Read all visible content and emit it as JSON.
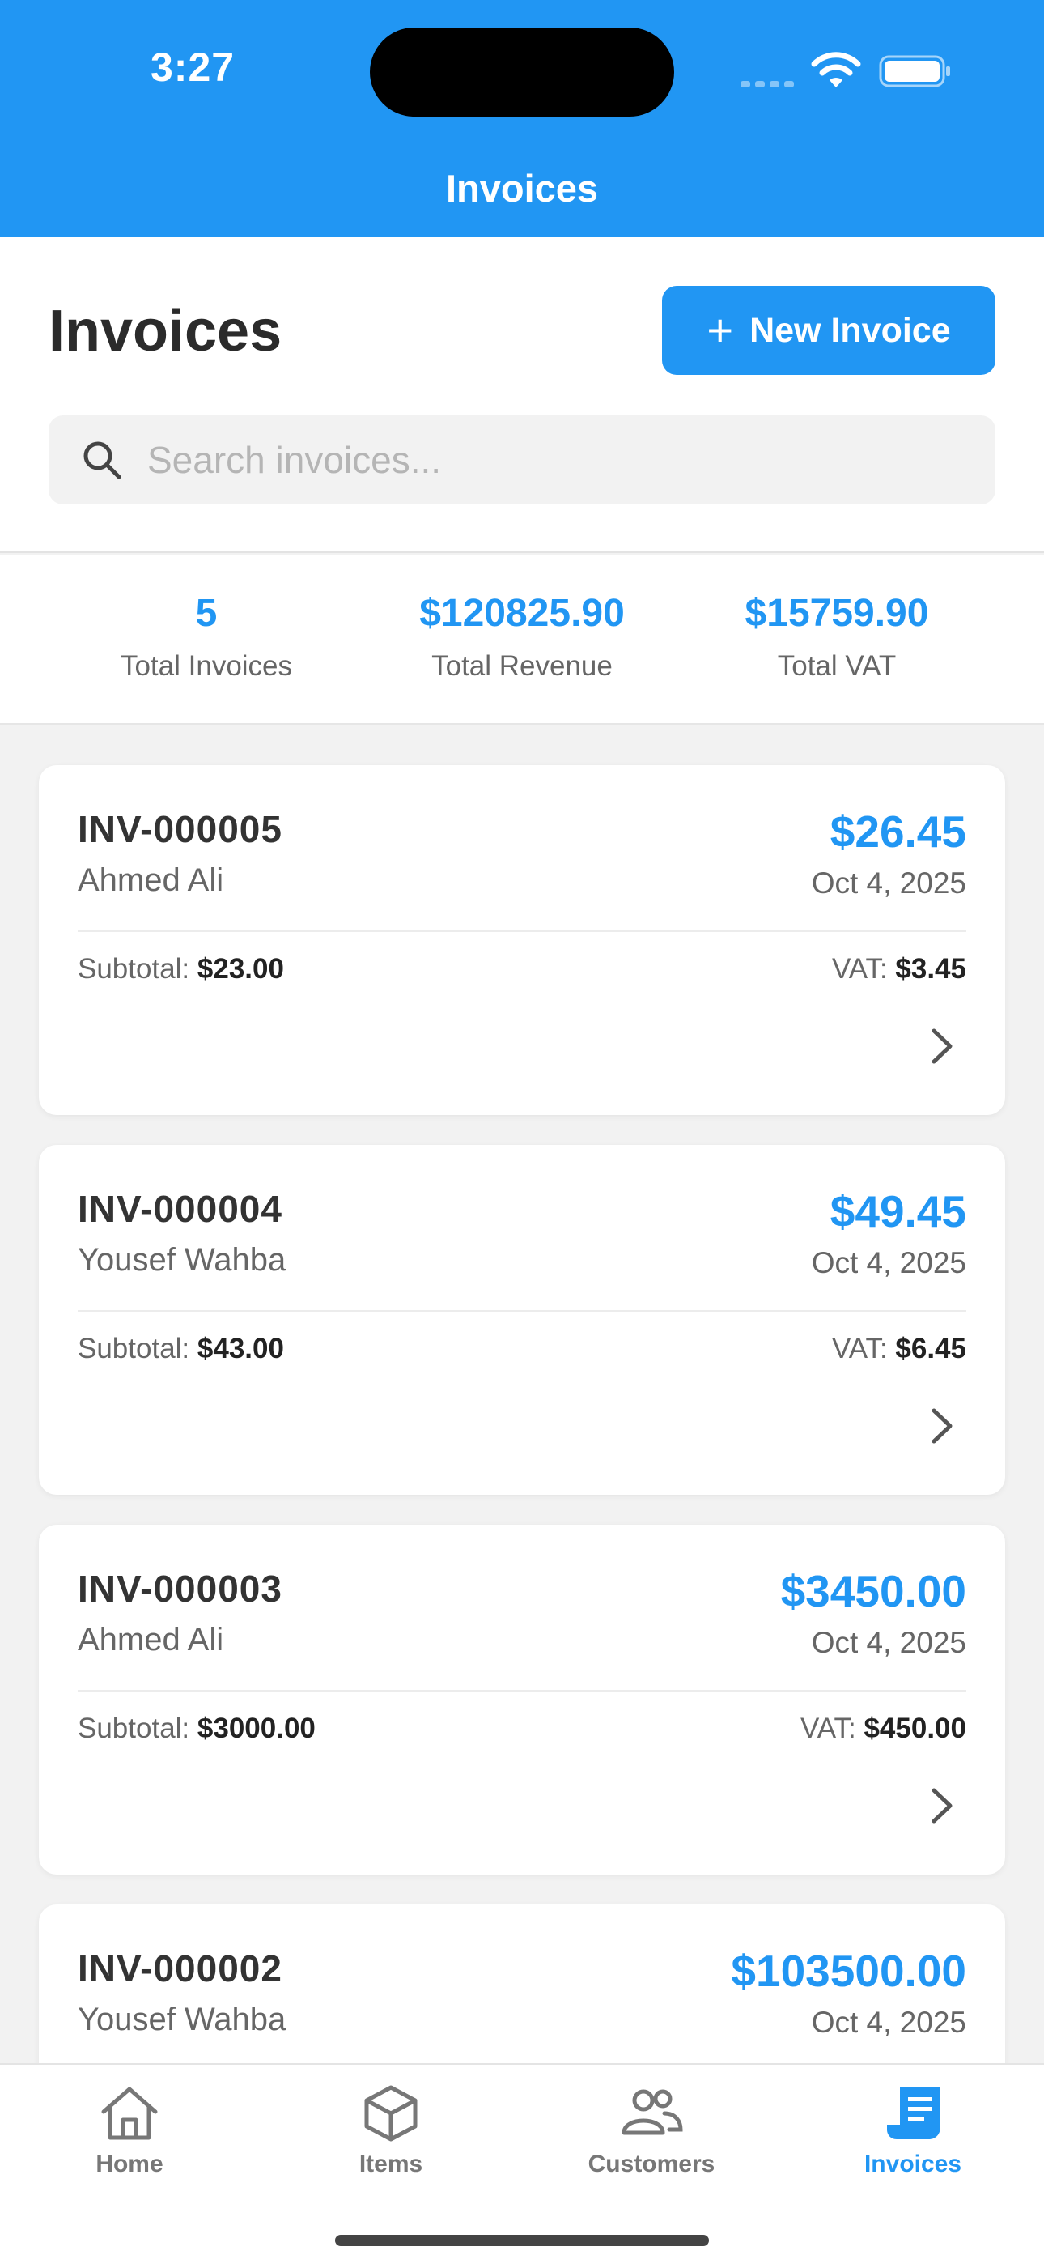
{
  "status_bar": {
    "time": "3:27"
  },
  "nav": {
    "title": "Invoices"
  },
  "header": {
    "title": "Invoices",
    "new_button_label": "New Invoice",
    "search_placeholder": "Search invoices..."
  },
  "stats": [
    {
      "value": "5",
      "label": "Total Invoices"
    },
    {
      "value": "$120825.90",
      "label": "Total Revenue"
    },
    {
      "value": "$15759.90",
      "label": "Total VAT"
    }
  ],
  "labels": {
    "subtotal": "Subtotal:",
    "vat": "VAT:"
  },
  "invoices": [
    {
      "number": "INV-000005",
      "customer": "Ahmed Ali",
      "amount": "$26.45",
      "date": "Oct 4, 2025",
      "subtotal": "$23.00",
      "vat": "$3.45"
    },
    {
      "number": "INV-000004",
      "customer": "Yousef Wahba",
      "amount": "$49.45",
      "date": "Oct 4, 2025",
      "subtotal": "$43.00",
      "vat": "$6.45"
    },
    {
      "number": "INV-000003",
      "customer": "Ahmed Ali",
      "amount": "$3450.00",
      "date": "Oct 4, 2025",
      "subtotal": "$3000.00",
      "vat": "$450.00"
    },
    {
      "number": "INV-000002",
      "customer": "Yousef Wahba",
      "amount": "$103500.00",
      "date": "Oct 4, 2025"
    }
  ],
  "tabs": [
    {
      "label": "Home",
      "icon": "home-icon"
    },
    {
      "label": "Items",
      "icon": "cube-icon"
    },
    {
      "label": "Customers",
      "icon": "people-icon"
    },
    {
      "label": "Invoices",
      "icon": "receipt-icon",
      "active": true
    }
  ],
  "colors": {
    "primary": "#2196f3",
    "background": "#f2f2f2",
    "text": "#333333",
    "muted": "#666666"
  }
}
